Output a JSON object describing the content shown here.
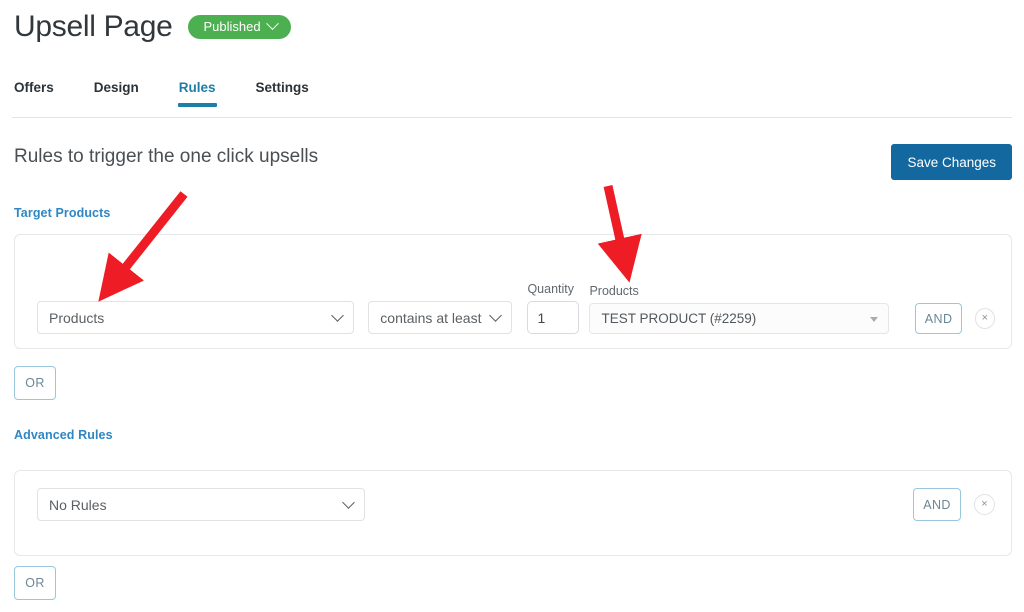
{
  "header": {
    "title": "Upsell Page",
    "status": {
      "label": "Published",
      "color": "#4caf50",
      "icon": "chevron-down-icon"
    }
  },
  "tabs": [
    {
      "label": "Offers",
      "active": false
    },
    {
      "label": "Design",
      "active": false
    },
    {
      "label": "Rules",
      "active": true
    },
    {
      "label": "Settings",
      "active": false
    }
  ],
  "main": {
    "section_heading": "Rules to trigger the one click upsells",
    "save_label": "Save Changes",
    "save_color": "#1468a0",
    "accent_color": "#2e87c4"
  },
  "target_products": {
    "group_label": "Target Products",
    "rule": {
      "subject": "Products",
      "operator": "contains at least",
      "quantity_label": "Quantity",
      "quantity_value": "1",
      "products_label": "Products",
      "product_value": "TEST PRODUCT (#2259)",
      "and_label": "AND",
      "remove_label": "×"
    },
    "or_label": "OR"
  },
  "advanced_rules": {
    "group_label": "Advanced Rules",
    "rule": {
      "subject": "No Rules",
      "and_label": "AND",
      "remove_label": "×"
    },
    "or_label": "OR"
  },
  "annotations": {
    "arrow_color": "#ee1c24",
    "arrow_1_target": "products-subject-select",
    "arrow_2_target": "products-value-select"
  }
}
